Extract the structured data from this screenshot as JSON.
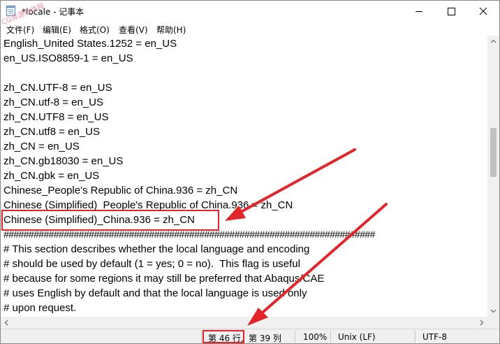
{
  "window": {
    "title": "*locale - 记事本",
    "icon": "notepad-icon",
    "controls": [
      "minimize-icon",
      "maximize-icon",
      "close-icon"
    ]
  },
  "menu": {
    "items": [
      "文件(F)",
      "编辑(E)",
      "格式(O)",
      "查看(V)",
      "帮助(H)"
    ]
  },
  "watermark": "CG资源软件网",
  "editor": {
    "lines": [
      "English_United States.1252 = en_US",
      "en_US.ISO8859-1 = en_US",
      "",
      "zh_CN.UTF-8 = en_US",
      "zh_CN.utf-8 = en_US",
      "zh_CN.UTF8 = en_US",
      "zh_CN.utf8 = en_US",
      "zh_CN = en_US",
      "zh_CN.gb18030 = en_US",
      "zh_CN.gbk = en_US",
      "Chinese_People's Republic of China.936 = zh_CN",
      "Chinese (Simplified)_People's Republic of China.936 = zh_CN",
      "Chinese (Simplified)_China.936 = zh_CN",
      "##########################################################################",
      "# This section describes whether the local language and encoding",
      "# should be used by default (1 = yes; 0 = no).  This flag is useful",
      "# because for some regions it may still be preferred that Abaqus/CAE",
      "# uses English by default and that the local language is used only",
      "# upon request."
    ],
    "highlighted_line": 12
  },
  "statusbar": {
    "position_line": "第 46 行,",
    "position_col": "第 39 列",
    "zoom": "100%",
    "line_ending": "Unix (LF)",
    "encoding": "UTF-8"
  },
  "annotation_color": "#e0262a"
}
